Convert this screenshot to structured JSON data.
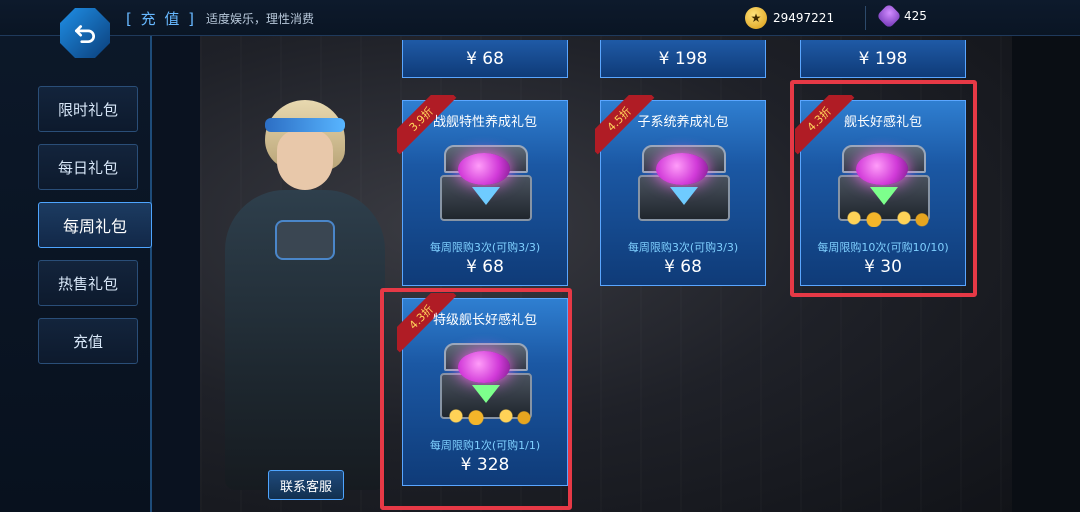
{
  "header": {
    "title": "[ 充 值 ]",
    "subtitle": "适度娱乐，理性消费",
    "gold_amount": "29497221",
    "gem_amount": "425"
  },
  "sidebar": {
    "items": [
      {
        "label": "限时礼包"
      },
      {
        "label": "每日礼包"
      },
      {
        "label": "每周礼包"
      },
      {
        "label": "热售礼包"
      },
      {
        "label": "充值"
      }
    ],
    "active_index": 2
  },
  "top_prices": [
    "¥ 68",
    "¥ 198",
    "¥ 198"
  ],
  "cards": [
    {
      "title": "战舰特性养成礼包",
      "discount": "3.9折",
      "limit": "每周限购3次(可购3/3)",
      "price": "¥ 68"
    },
    {
      "title": "子系统养成礼包",
      "discount": "4.5折",
      "limit": "每周限购3次(可购3/3)",
      "price": "¥ 68"
    },
    {
      "title": "舰长好感礼包",
      "discount": "4.3折",
      "limit": "每周限购10次(可购10/10)",
      "price": "¥ 30"
    },
    {
      "title": "特级舰长好感礼包",
      "discount": "4.3折",
      "limit": "每周限购1次(可购1/1)",
      "price": "¥ 328"
    }
  ],
  "customer_service_label": "联系客服",
  "colors": {
    "accent": "#4ea5ff",
    "highlight": "#e63946",
    "ribbon": "#b01c25"
  }
}
